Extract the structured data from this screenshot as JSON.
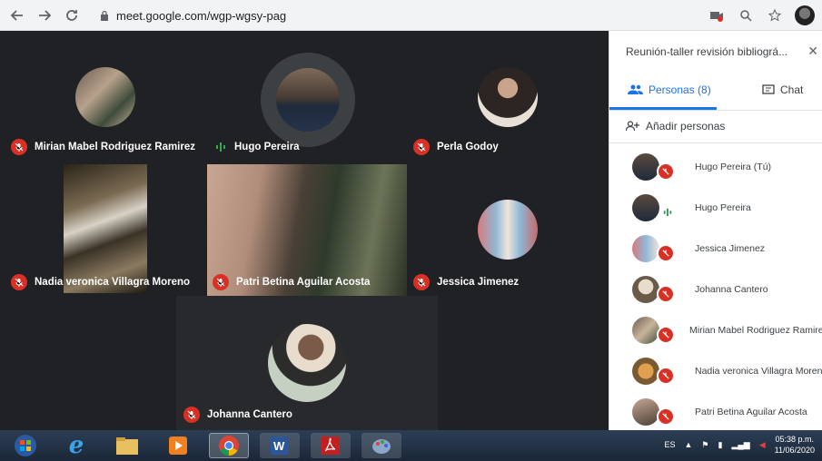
{
  "browser": {
    "url": "meet.google.com/wgp-wgsy-pag",
    "icons": [
      "back-icon",
      "forward-icon",
      "reload-icon",
      "lock-icon",
      "camera-blocked-icon",
      "zoom-icon",
      "star-icon",
      "profile-avatar"
    ]
  },
  "meeting": {
    "participants": [
      {
        "name": "Mirian Mabel Rodriguez Ramirez",
        "muted": true
      },
      {
        "name": "Hugo Pereira",
        "muted": false,
        "speaking": true
      },
      {
        "name": "Perla Godoy",
        "muted": true
      },
      {
        "name": "Nadia veronica Villagra Moreno",
        "muted": true
      },
      {
        "name": "Patri Betina Aguilar Acosta",
        "muted": true
      },
      {
        "name": "Jessica Jimenez",
        "muted": true
      },
      {
        "name": "Johanna Cantero",
        "muted": true
      }
    ]
  },
  "panel": {
    "title": "Reunión-taller revisión bibliográ...",
    "close_icon": "close-icon",
    "tabs": [
      {
        "label": "Personas (8)",
        "icon": "people-icon",
        "active": true
      },
      {
        "label": "Chat",
        "icon": "chat-icon",
        "active": false
      }
    ],
    "add_people_label": "Añadir personas",
    "people": [
      {
        "name": "Hugo Pereira (Tú)",
        "muted": true
      },
      {
        "name": "Hugo Pereira",
        "muted": false
      },
      {
        "name": "Jessica Jimenez",
        "muted": true
      },
      {
        "name": "Johanna Cantero",
        "muted": true
      },
      {
        "name": "Mirian Mabel Rodriguez Ramire",
        "muted": true
      },
      {
        "name": "Nadia veronica Villagra Moren",
        "muted": true
      },
      {
        "name": "Patri Betina Aguilar Acosta",
        "muted": true
      }
    ]
  },
  "taskbar": {
    "apps": [
      "windows-start-icon",
      "internet-explorer-icon",
      "file-explorer-icon",
      "media-player-icon",
      "chrome-icon",
      "word-icon",
      "acrobat-icon",
      "paint-icon"
    ],
    "language": "ES",
    "time": "05:38 p.m.",
    "date": "11/06/2020"
  },
  "colors": {
    "meet_bg": "#202124",
    "muted_red": "#d93025",
    "accent_blue": "#1a73e8",
    "speaking_green": "#1e8e3e"
  }
}
